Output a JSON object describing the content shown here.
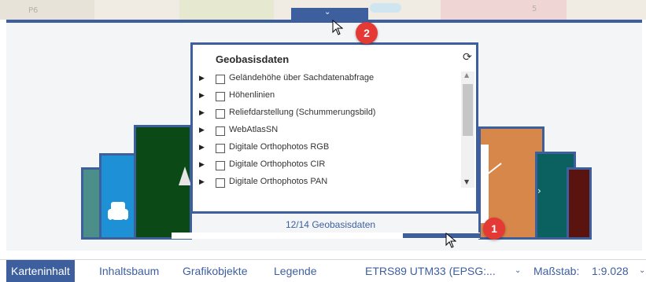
{
  "panel": {
    "title": "Geobasisdaten",
    "layers": [
      "Geländehöhe über Sachdatenabfrage",
      "Höhenlinien",
      "Reliefdarstellung (Schummerungsbild)",
      "WebAtlasSN",
      "Digitale Orthophotos RGB",
      "Digitale Orthophotos CIR",
      "Digitale Orthophotos PAN"
    ],
    "refresh_icon": "refresh-icon",
    "expand_icon": "caret-right-icon"
  },
  "pager": {
    "text": "12/14 Geobasisdaten"
  },
  "badges": {
    "one": "1",
    "two": "2"
  },
  "map_labels": [
    "P6",
    "5"
  ],
  "tabs": {
    "karteninhalt": "Karteninhalt",
    "inhaltsbaum": "Inhaltsbaum",
    "grafikobjekte": "Grafikobjekte",
    "legende": "Legende"
  },
  "crs": {
    "value": "ETRS89 UTM33 (EPSG:..."
  },
  "scale": {
    "label": "Maßstab:",
    "value": "1:9.028"
  },
  "colors": {
    "accent": "#3e5f9e",
    "badge": "#e53935",
    "card_teal": "#4c8f8a",
    "card_blue": "#1e90d6",
    "card_green": "#0b4a17",
    "card_orange": "#d8874a",
    "card_dark_teal": "#0b6160",
    "card_maroon": "#5a1410"
  }
}
